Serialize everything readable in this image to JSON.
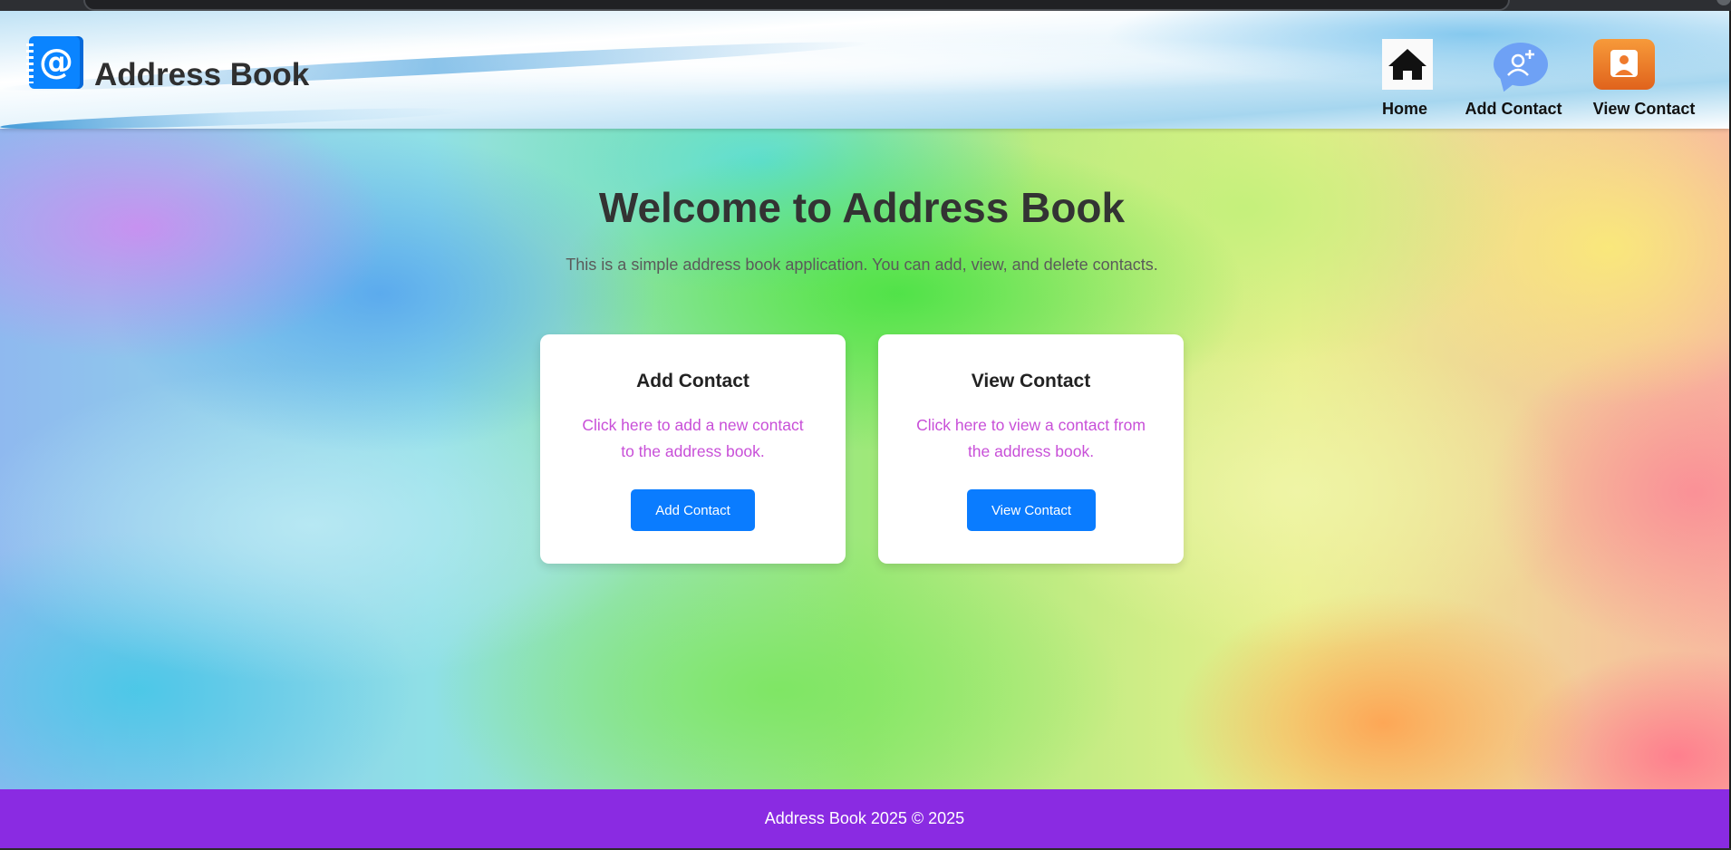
{
  "header": {
    "brand_title": "Address Book",
    "nav": [
      {
        "label": "Home",
        "icon": "home-icon"
      },
      {
        "label": "Add Contact",
        "icon": "add-user-icon"
      },
      {
        "label": "View Contact",
        "icon": "contact-card-icon"
      }
    ]
  },
  "main": {
    "heading": "Welcome to Address Book",
    "subtitle": "This is a simple address book application. You can add, view, and delete contacts.",
    "cards": [
      {
        "title": "Add Contact",
        "text": "Click here to add a new contact to the address book.",
        "button": "Add Contact"
      },
      {
        "title": "View Contact",
        "text": "Click here to view a contact from the address book.",
        "button": "View Contact"
      }
    ]
  },
  "footer": {
    "text": "Address Book 2025 © 2025"
  },
  "colors": {
    "primary_button": "#0a7cff",
    "footer_bg": "#8a2be2",
    "card_text": "#c84fd8",
    "logo_bg": "#0a84ff"
  }
}
